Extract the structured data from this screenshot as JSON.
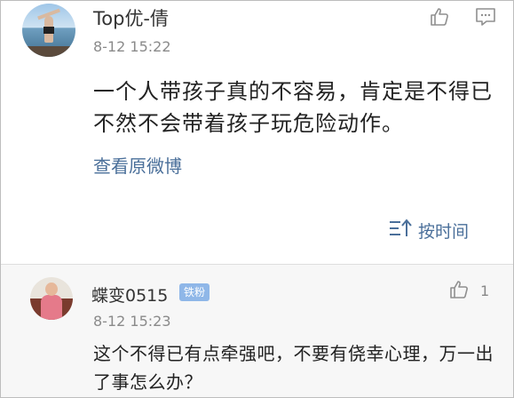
{
  "comments": [
    {
      "username": "Top优-倩",
      "time": "8-12 15:22",
      "text": "一个人带孩子真的不容易，肯定是不得已不然不会带着孩子玩危险动作。",
      "view_original": "查看原微博",
      "sort_label": "按时间"
    },
    {
      "username": "蝶变0515",
      "badge": "铁粉",
      "time": "8-12 15:23",
      "like_count": "1",
      "text": "这个不得已有点牵强吧，不要有侥幸心理，万一出了事怎么办？"
    }
  ],
  "icons": {
    "like": "thumbs-up-icon",
    "reply": "comment-icon",
    "sort": "sort-icon"
  },
  "colors": {
    "link": "#4a6f9a",
    "badge": "#8fb7e8"
  }
}
